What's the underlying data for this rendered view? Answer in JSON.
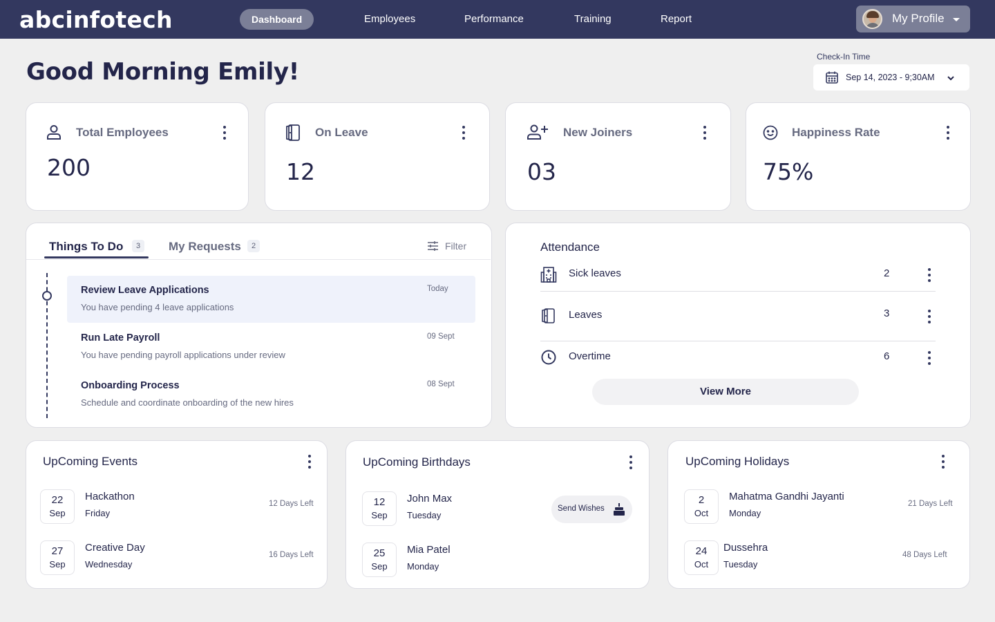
{
  "brand": {
    "name": "abcinfotech"
  },
  "nav": {
    "items": [
      {
        "label": "Dashboard",
        "active": true
      },
      {
        "label": "Employees",
        "active": false
      },
      {
        "label": "Performance",
        "active": false
      },
      {
        "label": "Training",
        "active": false
      },
      {
        "label": "Report",
        "active": false
      }
    ],
    "profile_label": "My Profile"
  },
  "greeting": "Good Morning Emily!",
  "checkin": {
    "label": "Check-In Time",
    "value": "Sep 14, 2023 - 9;30AM"
  },
  "stats": [
    {
      "title": "Total Employees",
      "value": "200",
      "icon": "user-icon"
    },
    {
      "title": "On Leave",
      "value": "12",
      "icon": "door-icon"
    },
    {
      "title": "New Joiners",
      "value": "03",
      "icon": "user-plus-icon"
    },
    {
      "title": "Happiness Rate",
      "value": "75%",
      "icon": "smile-icon"
    }
  ],
  "tasks": {
    "tabs": [
      {
        "label": "Things To Do",
        "count": "3",
        "active": true
      },
      {
        "label": "My Requests",
        "count": "2",
        "active": false
      }
    ],
    "filter_label": "Filter",
    "items": [
      {
        "title": "Review Leave Applications",
        "desc": "You have pending 4 leave applications",
        "date": "Today"
      },
      {
        "title": "Run Late Payroll",
        "desc": "You have pending payroll applications under review",
        "date": "09 Sept"
      },
      {
        "title": "Onboarding Process",
        "desc": "Schedule and coordinate onboarding of the new hires",
        "date": "08 Sept"
      }
    ]
  },
  "attendance": {
    "title": "Attendance",
    "rows": [
      {
        "label": "Sick leaves",
        "value": "2",
        "icon": "hospital-icon"
      },
      {
        "label": "Leaves",
        "value": "3",
        "icon": "door-icon"
      },
      {
        "label": "Overtime",
        "value": "6",
        "icon": "clock-icon"
      }
    ],
    "view_more": "View More"
  },
  "events": {
    "title": "UpComing Events",
    "items": [
      {
        "day": "22",
        "month": "Sep",
        "name": "Hackathon",
        "weekday": "Friday",
        "left": "12 Days Left"
      },
      {
        "day": "27",
        "month": "Sep",
        "name": "Creative Day",
        "weekday": "Wednesday",
        "left": "16 Days Left"
      }
    ]
  },
  "birthdays": {
    "title": "UpComing Birthdays",
    "send_wishes": "Send Wishes",
    "items": [
      {
        "day": "12",
        "month": "Sep",
        "name": "John Max",
        "weekday": "Tuesday"
      },
      {
        "day": "25",
        "month": "Sep",
        "name": "Mia Patel",
        "weekday": "Monday"
      }
    ]
  },
  "holidays": {
    "title": "UpComing Holidays",
    "items": [
      {
        "day": "2",
        "month": "Oct",
        "name": "Mahatma Gandhi Jayanti",
        "weekday": "Monday",
        "left": "21 Days Left"
      },
      {
        "day": "24",
        "month": "Oct",
        "name": "Dussehra",
        "weekday": "Tuesday",
        "left": "48 Days Left"
      }
    ]
  },
  "colors": {
    "navbar": "#33385f",
    "accent": "#23254a",
    "active_pill": "#7b7f97",
    "highlight": "#eff2fb",
    "background": "#efefef"
  }
}
